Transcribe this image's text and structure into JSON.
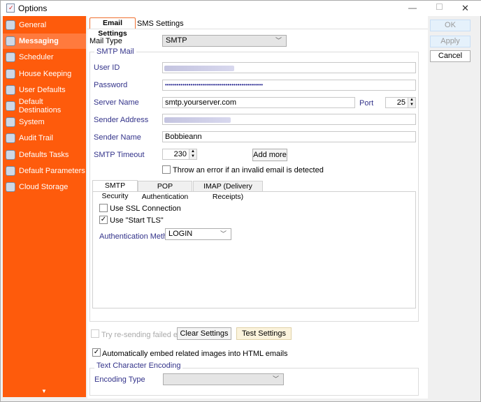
{
  "window": {
    "title": "Options",
    "minimize": "—",
    "maximize": "☐",
    "close": "✕"
  },
  "sidebar": {
    "items": [
      {
        "label": "General",
        "icon": "general-icon"
      },
      {
        "label": "Messaging",
        "icon": "messaging-icon",
        "active": true
      },
      {
        "label": "Scheduler",
        "icon": "scheduler-icon"
      },
      {
        "label": "House Keeping",
        "icon": "broom-icon"
      },
      {
        "label": "User Defaults",
        "icon": "users-icon"
      },
      {
        "label": "Default Destinations",
        "icon": "destination-icon"
      },
      {
        "label": "System",
        "icon": "globe-icon"
      },
      {
        "label": "Audit Trail",
        "icon": "audit-icon"
      },
      {
        "label": "Defaults Tasks",
        "icon": "tasks-icon"
      },
      {
        "label": "Default Parameters",
        "icon": "help-icon"
      },
      {
        "label": "Cloud Storage",
        "icon": "cloud-icon"
      }
    ],
    "scroll_down": "▼"
  },
  "tabs": [
    "Email Settings",
    "SMS Settings"
  ],
  "mail_type": {
    "label": "Mail Type",
    "value": "SMTP"
  },
  "smtp": {
    "group": "SMTP Mail",
    "user_id": "User ID",
    "password": "Password",
    "password_value": "••••••••••••••••••••••••••••••••••••••••••••••••••",
    "server_name": "Server Name",
    "server_value": "smtp.yourserver.com",
    "port": "Port",
    "port_value": "25",
    "sender_address": "Sender Address",
    "sender_name": "Sender Name",
    "sender_name_value": "Bobbieann",
    "timeout": "SMTP Timeout",
    "timeout_value": "230",
    "add_more": "Add more",
    "throw_error": "Throw an error if an invalid email is detected"
  },
  "inner_tabs": [
    "SMTP Security",
    "POP Authentication",
    "IMAP (Delivery Receipts)"
  ],
  "security": {
    "use_ssl": "Use SSL Connection",
    "use_tls": "Use \"Start TLS\"",
    "use_tls_checked": true,
    "auth_method": "Authentication Method",
    "auth_value": "LOGIN"
  },
  "bottom": {
    "retry": "Try re-sending failed emails",
    "clear": "Clear Settings",
    "test": "Test Settings",
    "embed": "Automatically embed related images into HTML emails",
    "embed_checked": true,
    "encoding_group": "Text Character Encoding",
    "encoding_type": "Encoding Type",
    "encoding_value": ""
  },
  "actions": {
    "ok": "OK",
    "apply": "Apply",
    "cancel": "Cancel"
  },
  "colors": {
    "sidebar": "#fe5b0c",
    "label": "#33338a",
    "accent_tab": "#f07030"
  }
}
